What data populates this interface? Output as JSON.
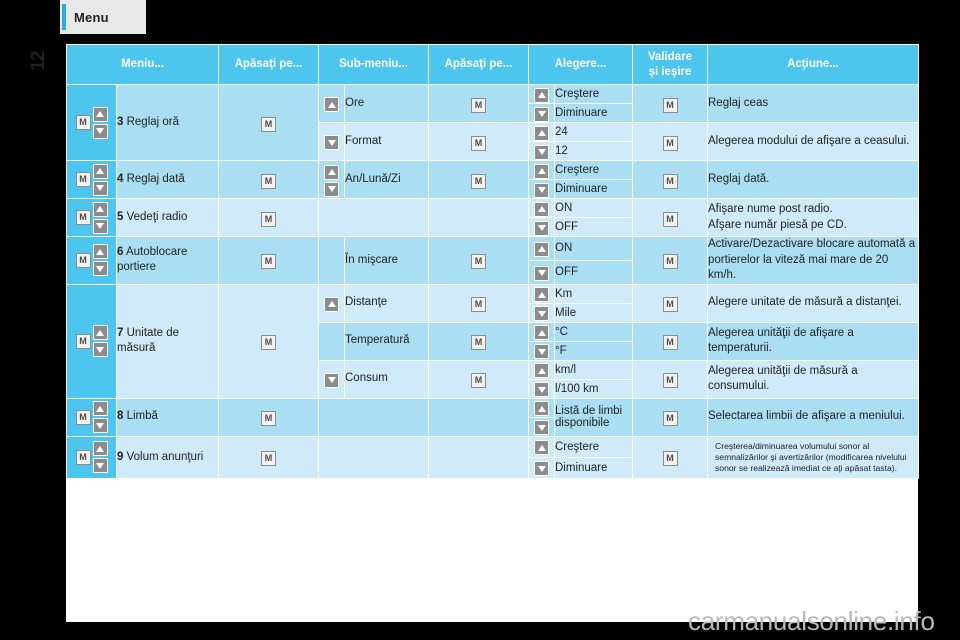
{
  "header": {
    "tab_label": "Menu",
    "side_number": "12"
  },
  "watermark": "carmanualsonline.info",
  "table": {
    "columns": [
      {
        "label": "Meniu..."
      },
      {
        "label": "Apăsaţi pe..."
      },
      {
        "label": "Sub-meniu..."
      },
      {
        "label": "Apăsaţi pe..."
      },
      {
        "label": "Alegere..."
      },
      {
        "label": "Validare\nşi ieşire"
      },
      {
        "label": "Acţiune..."
      }
    ],
    "column_header_validare_line1": "Validare",
    "column_header_validare_line2": "şi ieşire",
    "keys": {
      "m": "M",
      "up": "▲",
      "down": "▼"
    },
    "rows": [
      {
        "num": "3",
        "menu": "Reglaj oră",
        "press": "M",
        "subrows": [
          {
            "sub": "Ore",
            "sub_arrow": "up",
            "press2": "M",
            "choices": [
              "Creştere",
              "Diminuare"
            ],
            "validate": "M",
            "action": "Reglaj ceas"
          },
          {
            "sub": "Format",
            "sub_arrow": "down",
            "press2": "M",
            "choices": [
              "24",
              "12"
            ],
            "validate": "M",
            "action": "Alegerea modului de afişare a ceasului."
          }
        ]
      },
      {
        "num": "4",
        "menu": "Reglaj dată",
        "press": "M",
        "subrows": [
          {
            "sub": "An/Lună/Zi",
            "sub_arrow": "both",
            "press2": "M",
            "choices": [
              "Creştere",
              "Diminuare"
            ],
            "validate": "M",
            "action": "Reglaj dată."
          }
        ]
      },
      {
        "num": "5",
        "menu": "Vedeţi radio",
        "press": "M",
        "subrows": [
          {
            "sub": "",
            "sub_arrow": "none",
            "press2": "",
            "choices": [
              "ON",
              "OFF"
            ],
            "validate": "M",
            "action": "Afişare nume post radio.\nAfşare număr piesă pe CD."
          }
        ]
      },
      {
        "num": "6",
        "menu": "Autoblocare portiere",
        "press": "M",
        "subrows": [
          {
            "sub": "În mişcare",
            "sub_arrow": "none",
            "press2": "M",
            "choices": [
              "ON",
              "OFF"
            ],
            "validate": "M",
            "action": "Activare/Dezactivare blocare automată a portierelor la viteză mai mare de 20 km/h."
          }
        ]
      },
      {
        "num": "7",
        "menu": "Unitate de măsură",
        "press": "M",
        "subrows": [
          {
            "sub": "Distanţe",
            "sub_arrow": "up",
            "press2": "M",
            "choices": [
              "Km",
              "Mile"
            ],
            "validate": "M",
            "action": "Alegere unitate de măsură a distanţei."
          },
          {
            "sub": "Temperatură",
            "sub_arrow": "none",
            "press2": "M",
            "choices": [
              "°C",
              "°F"
            ],
            "validate": "M",
            "action": "Alegerea unităţii de afişare a temperaturii."
          },
          {
            "sub": "Consum",
            "sub_arrow": "down",
            "press2": "M",
            "choices": [
              "km/l",
              "l/100 km"
            ],
            "validate": "M",
            "action": "Alegerea unităţii de măsură a consumului."
          }
        ]
      },
      {
        "num": "8",
        "menu": "Limbă",
        "press": "M",
        "subrows": [
          {
            "sub": "",
            "sub_arrow": "none",
            "press2": "",
            "choices": [
              "Listă de limbi disponibile"
            ],
            "validate": "M",
            "action": "Selectarea limbii de afişare a meniului."
          }
        ]
      },
      {
        "num": "9",
        "menu": "Volum anunţuri",
        "press": "M",
        "subrows": [
          {
            "sub": "",
            "sub_arrow": "none",
            "press2": "",
            "choices": [
              "Creştere",
              "Diminuare"
            ],
            "validate": "M",
            "action": "Creşterea/diminuarea volumului sonor al semnalizărilor şi avertizărilor (modificarea nivelului sonor se realizează imediat ce aţi apăsat tasta)."
          }
        ]
      }
    ]
  },
  "colors": {
    "accent": "#29abe2",
    "header_blue": "#4cc6ef",
    "band_mid": "#aadef3",
    "band_light": "#cfeaf8",
    "page_bg": "#000000"
  }
}
